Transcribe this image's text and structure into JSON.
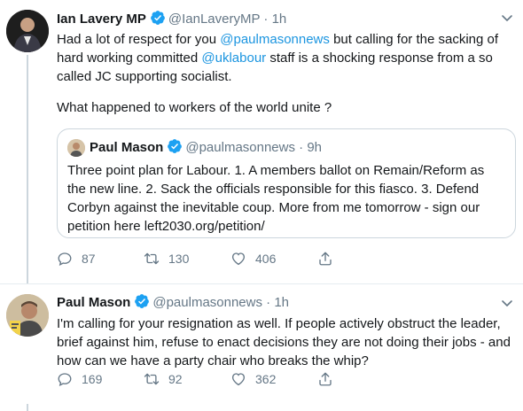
{
  "tweet1": {
    "author_name": "Ian Lavery MP",
    "handle": "@IanLaveryMP",
    "dot": "·",
    "time": "1h",
    "text_part1": "Had a lot of respect for you ",
    "mention1": "@paulmasonnews",
    "text_part2": " but calling for the sacking of hard working committed ",
    "mention2": "@uklabour",
    "text_part3": "  staff is a shocking response from a so called JC supporting  socialist.",
    "text_para2": "What happened to workers of the world unite ?",
    "quote": {
      "author_name": "Paul Mason",
      "handle": "@paulmasonnews",
      "dot": "·",
      "time": "9h",
      "text": "Three point plan for Labour. 1. A members ballot on Remain/Reform as the new line. 2. Sack the officials responsible for this fiasco. 3. Defend Corbyn against the inevitable coup. More from me tomorrow - sign our petition here left2030.org/petition/"
    },
    "replies": "87",
    "retweets": "130",
    "likes": "406"
  },
  "tweet2": {
    "author_name": "Paul Mason",
    "handle": "@paulmasonnews",
    "dot": "·",
    "time": "1h",
    "text": "I'm calling for your resignation as well. If people actively obstruct the leader, brief against him, refuse to enact decisions they are not doing their jobs - and how can we have a party chair who breaks the whip?",
    "replies": "169",
    "retweets": "92",
    "likes": "362"
  },
  "colors": {
    "link": "#1b95e0",
    "verified": "#1da1f2",
    "secondary_text": "#657786",
    "border": "#ccd6dd"
  },
  "icons": [
    "verified-badge-icon",
    "caret-down-icon",
    "reply-icon",
    "retweet-icon",
    "like-icon",
    "share-icon"
  ]
}
